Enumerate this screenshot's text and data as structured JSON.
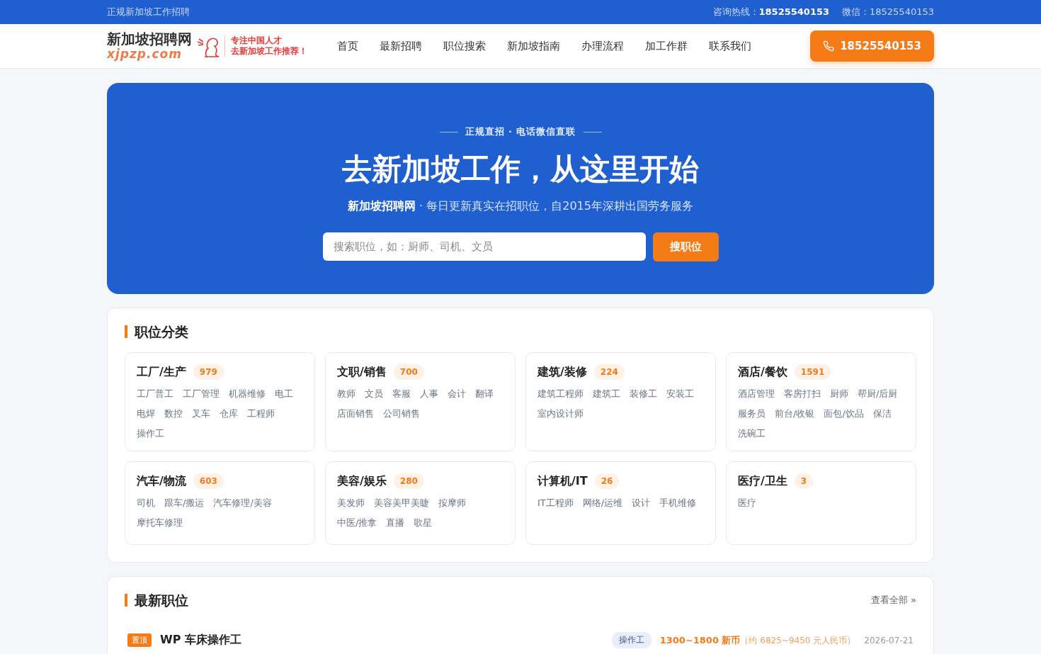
{
  "top_bar": {
    "tagline": "正规新加坡工作招聘",
    "hotline_label": "咨询热线：",
    "hotline": "18525540153",
    "wechat": "微信：18525540153"
  },
  "header": {
    "logo_title": "新加坡招聘网",
    "logo_domain": "xjpzp.com",
    "slogan_lines": [
      "专注中国人才",
      "去新加坡工作推荐！"
    ],
    "nav": [
      {
        "label": "首页",
        "selected": false
      },
      {
        "label": "最新招聘",
        "selected": false
      },
      {
        "label": "职位搜索",
        "selected": false
      },
      {
        "label": "新加坡指南",
        "selected": false
      },
      {
        "label": "办理流程",
        "selected": false
      },
      {
        "label": "加工作群",
        "selected": false
      },
      {
        "label": "联系我们",
        "selected": false
      }
    ],
    "phone_button": "18525540153"
  },
  "hero": {
    "eyebrow": "正规直招 · 电话微信直联",
    "title": "去新加坡工作，从这里开始",
    "subtitle": "**新加坡招聘网** · 每日更新真实在招职位，自2015年深耕出国劳务服务",
    "search": {
      "placeholder": "搜索职位，如：厨师、司机、文员"
    },
    "search_button": "搜职位"
  },
  "categories": {
    "title": "职位分类",
    "items": [
      {
        "name": "工厂/生产",
        "count": "979",
        "jobs": [
          "工厂普工",
          "工厂管理",
          "机器维修",
          "电工",
          "电焊",
          "数控",
          "叉车",
          "仓库",
          "工程师",
          "操作工"
        ]
      },
      {
        "name": "文职/销售",
        "count": "700",
        "jobs": [
          "教师",
          "文员",
          "客服",
          "人事",
          "会计",
          "翻译",
          "店面销售",
          "公司销售"
        ]
      },
      {
        "name": "建筑/装修",
        "count": "224",
        "jobs": [
          "建筑工程师",
          "建筑工",
          "装修工",
          "安装工",
          "室内设计师"
        ]
      },
      {
        "name": "酒店/餐饮",
        "count": "1591",
        "jobs": [
          "酒店管理",
          "客房打扫",
          "厨师",
          "帮厨/后厨",
          "服务员",
          "前台/收银",
          "面包/饮品",
          "保洁",
          "洗碗工"
        ]
      },
      {
        "name": "汽车/物流",
        "count": "603",
        "jobs": [
          "司机",
          "跟车/搬运",
          "汽车修理/美容",
          "摩托车修理"
        ]
      },
      {
        "name": "美容/娱乐",
        "count": "280",
        "jobs": [
          "美发师",
          "美容美甲美睫",
          "按摩师",
          "中医/推拿",
          "直播",
          "歌星"
        ]
      },
      {
        "name": "计算机/IT",
        "count": "26",
        "jobs": [
          "IT工程师",
          "网络/运维",
          "设计",
          "手机维修"
        ]
      },
      {
        "name": "医疗/卫生",
        "count": "3",
        "jobs": [
          "医疗"
        ]
      }
    ]
  },
  "latest": {
    "title": "最新职位",
    "view_all": "查看全部 »",
    "jobs": [
      {
        "pinned": true,
        "pin_label": "置顶",
        "title": "WP 车床操作工",
        "tag": "操作工",
        "salary": "1300~1800 新币",
        "salary_rmb": "（约 6825~9450 元人民币）",
        "date": "2026-07-21"
      }
    ]
  }
}
